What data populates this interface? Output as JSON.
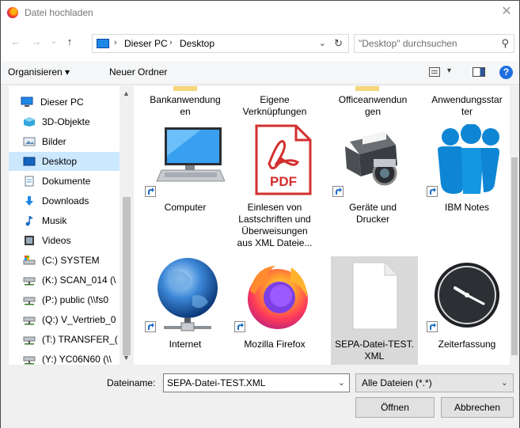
{
  "window": {
    "title": "Datei hochladen",
    "close_glyph": "✕"
  },
  "nav": {
    "back": "←",
    "forward": "→",
    "recent": "⌄",
    "up": "↑"
  },
  "address": {
    "crumbs": [
      "Dieser PC",
      "Desktop"
    ],
    "separator": "›",
    "dropdown": "⌄",
    "refresh": "↻"
  },
  "search": {
    "placeholder": "\"Desktop\" durchsuchen",
    "icon_glyph": "⚲"
  },
  "toolbar": {
    "organize": "Organisieren ▾",
    "new_folder": "Neuer Ordner",
    "view_dropdown": "▾",
    "help": "?"
  },
  "sidebar": {
    "items": [
      {
        "label": "Dieser PC",
        "icon": "pc-icon"
      },
      {
        "label": "3D-Objekte",
        "icon": "3d-objects-icon"
      },
      {
        "label": "Bilder",
        "icon": "pictures-icon"
      },
      {
        "label": "Desktop",
        "icon": "desktop-icon",
        "selected": true
      },
      {
        "label": "Dokumente",
        "icon": "documents-icon"
      },
      {
        "label": "Downloads",
        "icon": "downloads-icon"
      },
      {
        "label": "Musik",
        "icon": "music-icon"
      },
      {
        "label": "Videos",
        "icon": "videos-icon"
      },
      {
        "label": "(C:) SYSTEM",
        "icon": "system-drive-icon"
      },
      {
        "label": "(K:) SCAN_014 (\\",
        "icon": "network-drive-icon"
      },
      {
        "label": "(P:) public (\\\\fs0",
        "icon": "network-drive-icon"
      },
      {
        "label": "(Q:) V_Vertrieb_0",
        "icon": "network-drive-icon"
      },
      {
        "label": "(T:) TRANSFER_(",
        "icon": "network-drive-icon"
      },
      {
        "label": "(Y:) YC06N60 (\\\\",
        "icon": "network-drive-icon"
      }
    ],
    "scroll_up": "▲",
    "scroll_down": "▼"
  },
  "files": {
    "row0": [
      {
        "label": "Bankanwendung\nen"
      },
      {
        "label": "Eigene\nVerknüpfungen"
      },
      {
        "label": "Officeanwendun\ngen"
      },
      {
        "label": "Anwendungsstar\nter"
      }
    ],
    "row1": [
      {
        "label": "Computer",
        "icon": "computer-icon"
      },
      {
        "label": "Einlesen von\nLastschriften und\nÜberweisungen\naus XML Dateie...",
        "icon": "pdf-icon"
      },
      {
        "label": "Geräte und\nDrucker",
        "icon": "printer-icon"
      },
      {
        "label": "IBM Notes",
        "icon": "ibm-notes-icon"
      }
    ],
    "row2": [
      {
        "label": "Internet",
        "icon": "globe-icon"
      },
      {
        "label": "Mozilla Firefox",
        "icon": "firefox-icon"
      },
      {
        "label": "SEPA-Datei-TEST.\nXML",
        "icon": "document-icon",
        "selected": true
      },
      {
        "label": "Zeiterfassung",
        "icon": "clock-icon"
      }
    ],
    "pdf_text": "PDF"
  },
  "footer": {
    "filename_label": "Dateiname:",
    "filename_value": "SEPA-Datei-TEST.XML",
    "filetype": "Alle Dateien (*.*)",
    "dropdown": "⌄",
    "open_button": "Öffnen",
    "cancel_button": "Abbrechen"
  }
}
